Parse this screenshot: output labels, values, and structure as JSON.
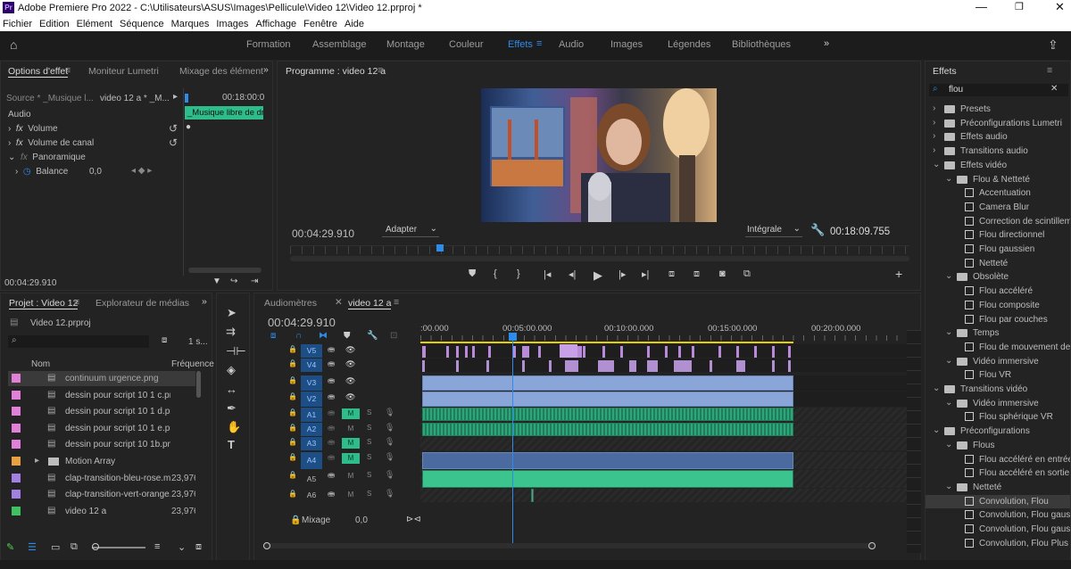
{
  "app": {
    "title": "Adobe Premiere Pro 2022 - C:\\Utilisateurs\\ASUS\\Images\\Pellicule\\Video 12\\Video 12.prproj *",
    "logo": "Pr"
  },
  "menu": [
    "Fichier",
    "Edition",
    "Elément",
    "Séquence",
    "Marques",
    "Images",
    "Affichage",
    "Fenêtre",
    "Aide"
  ],
  "workspaces": [
    "Formation",
    "Assemblage",
    "Montage",
    "Couleur",
    "Effets",
    "Audio",
    "Images",
    "Légendes",
    "Bibliothèques"
  ],
  "workspace_active": "Effets",
  "effect_controls": {
    "tabs": [
      "Options d'effet",
      "Moniteur Lumetri",
      "Mixage des élément"
    ],
    "source": "Source * _Musique l...",
    "sequence": "video 12 a * _M...",
    "time_end": "00:18:00:0",
    "clip": "_Musique libre de dro",
    "section": "Audio",
    "rows": [
      "Volume",
      "Volume de canal",
      "Panoramique",
      "Balance"
    ],
    "balance_value": "0,0",
    "timecode": "00:04:29.910"
  },
  "program": {
    "title": "Programme : video 12 a",
    "timecode": "00:04:29.910",
    "fit": "Adapter",
    "quality": "Intégrale",
    "duration": "00:18:09.755"
  },
  "effects_panel": {
    "title": "Effets",
    "search": "flou",
    "items": [
      {
        "label": "Presets",
        "level": 0,
        "type": "folder"
      },
      {
        "label": "Préconfigurations Lumetri",
        "level": 0,
        "type": "folder"
      },
      {
        "label": "Effets audio",
        "level": 0,
        "type": "folder"
      },
      {
        "label": "Transitions audio",
        "level": 0,
        "type": "folder"
      },
      {
        "label": "Effets vidéo",
        "level": 0,
        "type": "folder"
      },
      {
        "label": "Flou & Netteté",
        "level": 1,
        "type": "folder"
      },
      {
        "label": "Accentuation",
        "level": 2,
        "type": "fx"
      },
      {
        "label": "Camera Blur",
        "level": 2,
        "type": "fx"
      },
      {
        "label": "Correction de scintilleme",
        "level": 2,
        "type": "fx"
      },
      {
        "label": "Flou directionnel",
        "level": 2,
        "type": "fx"
      },
      {
        "label": "Flou gaussien",
        "level": 2,
        "type": "fx"
      },
      {
        "label": "Netteté",
        "level": 2,
        "type": "fx"
      },
      {
        "label": "Obsolète",
        "level": 1,
        "type": "folder"
      },
      {
        "label": "Flou accéléré",
        "level": 2,
        "type": "fx"
      },
      {
        "label": "Flou composite",
        "level": 2,
        "type": "fx"
      },
      {
        "label": "Flou par couches",
        "level": 2,
        "type": "fx"
      },
      {
        "label": "Temps",
        "level": 1,
        "type": "folder"
      },
      {
        "label": "Flou de mouvement des",
        "level": 2,
        "type": "fx"
      },
      {
        "label": "Vidéo immersive",
        "level": 1,
        "type": "folder"
      },
      {
        "label": "Flou VR",
        "level": 2,
        "type": "fx"
      },
      {
        "label": "Transitions vidéo",
        "level": 0,
        "type": "folder"
      },
      {
        "label": "Vidéo immersive",
        "level": 1,
        "type": "folder"
      },
      {
        "label": "Flou sphérique VR",
        "level": 2,
        "type": "fx"
      },
      {
        "label": "Préconfigurations",
        "level": 0,
        "type": "folder"
      },
      {
        "label": "Flous",
        "level": 1,
        "type": "folder"
      },
      {
        "label": "Flou accéléré en entrée",
        "level": 2,
        "type": "fx"
      },
      {
        "label": "Flou accéléré en sortie",
        "level": 2,
        "type": "fx"
      },
      {
        "label": "Netteté",
        "level": 1,
        "type": "folder"
      },
      {
        "label": "Convolution, Flou",
        "level": 2,
        "type": "fx"
      },
      {
        "label": "Convolution, Flou gaussi",
        "level": 2,
        "type": "fx"
      },
      {
        "label": "Convolution, Flou gaussi",
        "level": 2,
        "type": "fx"
      },
      {
        "label": "Convolution, Flou Plus",
        "level": 2,
        "type": "fx"
      }
    ]
  },
  "project": {
    "tabs": [
      "Projet : Video 12",
      "Explorateur de médias"
    ],
    "file": "Video 12.prproj",
    "count": "1 s...",
    "col_name": "Nom",
    "col_rate": "Fréquence",
    "items": [
      {
        "name": "continuum urgence.png",
        "rate": "",
        "color": "#e080d8"
      },
      {
        "name": "dessin pour script 10 1 c.pn",
        "rate": "",
        "color": "#e080d8"
      },
      {
        "name": "dessin pour script 10 1 d.pn",
        "rate": "",
        "color": "#e080d8"
      },
      {
        "name": "dessin pour script 10 1 e.pn",
        "rate": "",
        "color": "#e080d8"
      },
      {
        "name": "dessin pour script 10 1b.png",
        "rate": "",
        "color": "#e080d8"
      },
      {
        "name": "Motion Array",
        "rate": "",
        "color": "#e8a040"
      },
      {
        "name": "clap-transition-bleu-rose.m",
        "rate": "23,976",
        "color": "#a080e0"
      },
      {
        "name": "clap-transition-vert-orange.",
        "rate": "23,976",
        "color": "#a080e0"
      },
      {
        "name": "video 12 a",
        "rate": "23,976",
        "color": "#40c060"
      }
    ]
  },
  "timeline": {
    "tabs": [
      "Audiomètres",
      "video 12 a"
    ],
    "timecode": "00:04:29.910",
    "ruler": [
      ":00.000",
      "00:05:00.000",
      "00:10:00.000",
      "00:15:00.000",
      "00:20:00.000"
    ],
    "tracks": [
      "V5",
      "V4",
      "V3",
      "V2",
      "A1",
      "A2",
      "A3",
      "A4",
      "A5",
      "A6"
    ],
    "mix_label": "Mixage",
    "mix_value": "0,0"
  }
}
